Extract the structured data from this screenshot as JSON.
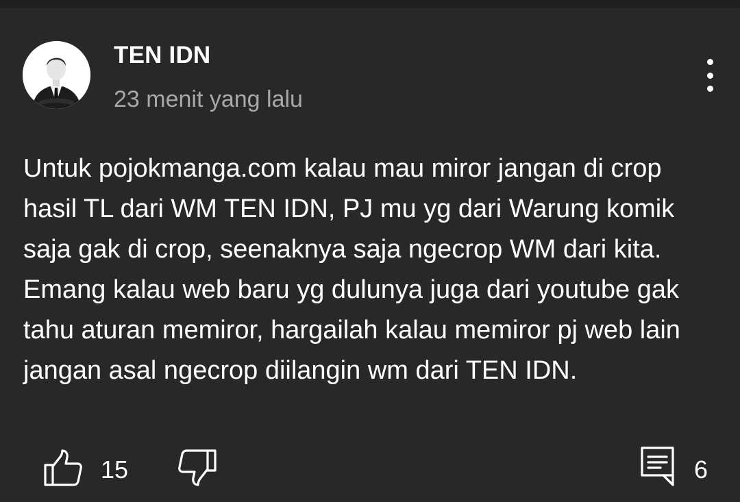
{
  "comment": {
    "author": "TEN IDN",
    "timestamp": "23 menit yang lalu",
    "body": "Untuk pojokmanga.com kalau mau miror jangan di crop hasil TL dari WM TEN IDN, PJ mu yg dari Warung komik saja gak di crop, seenaknya saja ngecrop WM dari kita. Emang kalau web baru yg dulunya juga dari youtube gak tahu aturan memiror, hargailah kalau memiror pj web lain jangan asal ngecrop diilangin wm dari TEN IDN.",
    "like_count": "15",
    "reply_count": "6"
  },
  "icons": {
    "avatar": "man-in-suit-avatar",
    "more": "more-vertical-icon",
    "like": "thumbs-up-icon",
    "dislike": "thumbs-down-icon",
    "reply": "comment-reply-icon"
  },
  "colors": {
    "background": "#282828",
    "primary_text": "#ffffff",
    "secondary_text": "#a8a8a8"
  }
}
